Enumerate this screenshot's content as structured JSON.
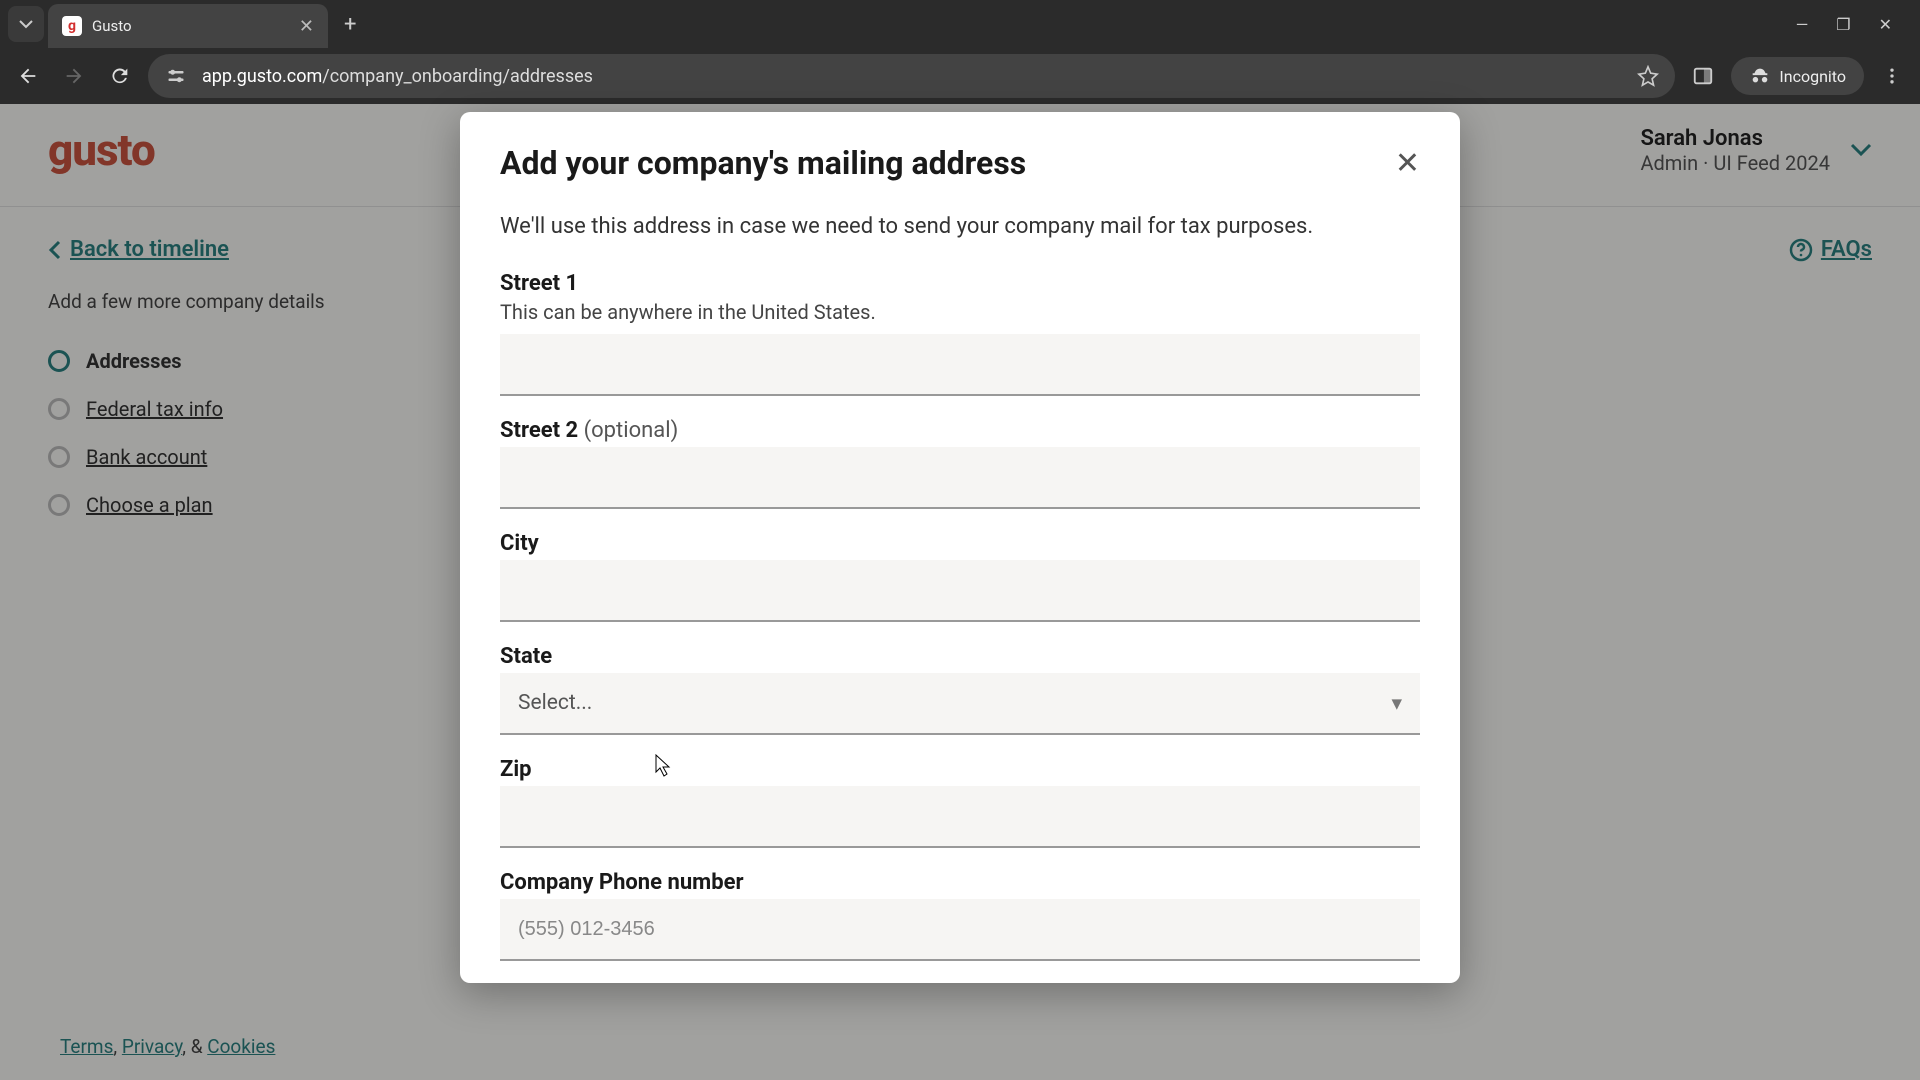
{
  "browser": {
    "tab_title": "Gusto",
    "url_host": "app.gusto.com",
    "url_path": "/company_onboarding/addresses",
    "incognito_label": "Incognito"
  },
  "header": {
    "logo": "gusto",
    "user_name": "Sarah Jonas",
    "user_role": "Admin · UI Feed 2024"
  },
  "sidebar": {
    "back_label": "Back to timeline",
    "heading": "Add a few more company details",
    "steps": [
      {
        "label": "Addresses",
        "active": true
      },
      {
        "label": "Federal tax info",
        "active": false
      },
      {
        "label": "Bank account",
        "active": false
      },
      {
        "label": "Choose a plan",
        "active": false
      }
    ]
  },
  "content": {
    "faqs_label": "FAQs"
  },
  "footer": {
    "terms": "Terms",
    "privacy": "Privacy",
    "cookies": "Cookies",
    "sep1": ", ",
    "sep2": ", & "
  },
  "modal": {
    "title": "Add your company's mailing address",
    "description": "We'll use this address in case we need to send your company mail for tax purposes.",
    "fields": {
      "street1": {
        "label": "Street 1",
        "help": "This can be anywhere in the United States.",
        "value": ""
      },
      "street2": {
        "label": "Street 2 ",
        "optional": "(optional)",
        "value": ""
      },
      "city": {
        "label": "City",
        "value": ""
      },
      "state": {
        "label": "State",
        "placeholder": "Select..."
      },
      "zip": {
        "label": "Zip",
        "value": ""
      },
      "phone": {
        "label": "Company Phone number",
        "placeholder": "(555) 012-3456",
        "value": ""
      }
    }
  }
}
